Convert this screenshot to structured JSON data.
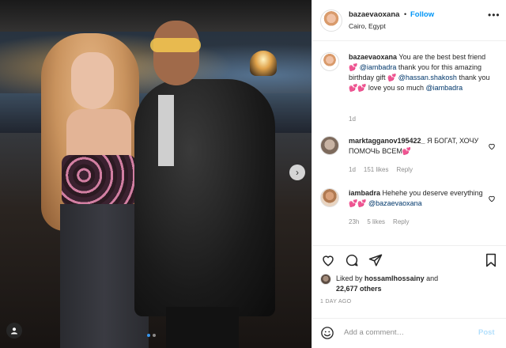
{
  "post": {
    "username": "bazaevaoxana",
    "separator": "•",
    "follow_label": "Follow",
    "location": "Cairo, Egypt",
    "more_icon": "more-horizontal-icon"
  },
  "caption": {
    "username": "bazaevaoxana",
    "text_1": "You are the best best friend 💕",
    "mention_1": "@iambadra",
    "text_2": "thank you for this amazing birthday gift 💕",
    "mention_2": "@hassan.shakosh",
    "text_3": "thank you 💕💕 love you so much",
    "mention_3": "@iambadra",
    "age": "1d"
  },
  "comments": [
    {
      "username": "marktagganov195422_",
      "text": "Я БОГАТ, ХОЧУ ПОМОЧЬ ВСЕМ💕",
      "age": "1d",
      "likes": "151 likes",
      "reply": "Reply"
    },
    {
      "username": "iambadra",
      "text": "Hehehe you deserve everything 💕💕",
      "mention": "@bazaevaoxana",
      "age": "23h",
      "likes": "5 likes",
      "reply": "Reply"
    }
  ],
  "engagement": {
    "liked_by_prefix": "Liked by",
    "liked_by_user": "hossamlhossainy",
    "and": "and",
    "others": "22,677 others",
    "time_ago": "1 DAY AGO"
  },
  "add_comment": {
    "placeholder": "Add a comment…",
    "post_label": "Post"
  },
  "carousel": {
    "slide_count": 2,
    "active_slide": 1
  },
  "colors": {
    "link": "#0095f6",
    "mention": "#00376b",
    "muted": "#8e8e8e",
    "post_disabled": "#b2dffc"
  }
}
